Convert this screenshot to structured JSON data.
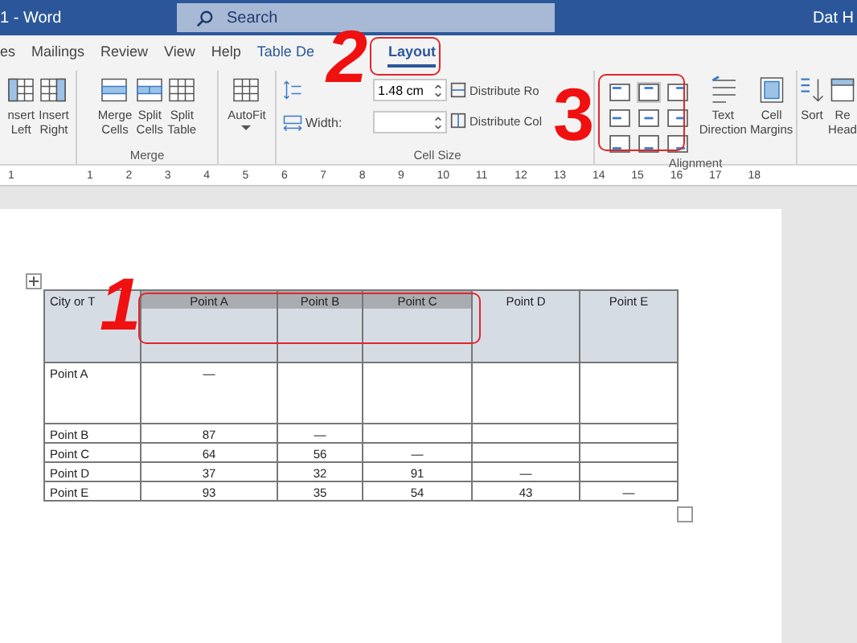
{
  "title_bar": {
    "doc_title": "1 - Word",
    "search_placeholder": "Search",
    "user": "Dat H"
  },
  "tabs": [
    {
      "label": "es",
      "selected": false
    },
    {
      "label": "Mailings",
      "selected": false
    },
    {
      "label": "Review",
      "selected": false
    },
    {
      "label": "View",
      "selected": false
    },
    {
      "label": "Help",
      "selected": false
    },
    {
      "label": "Table De",
      "selected": false
    },
    {
      "label": "Layout",
      "selected": true
    }
  ],
  "ribbon": {
    "groups": [
      {
        "items": [
          {
            "kind": "button",
            "lines": [
              "nsert",
              "Left"
            ]
          },
          {
            "kind": "button",
            "lines": [
              "Insert",
              "Right"
            ]
          }
        ]
      },
      {
        "label": "Merge",
        "items": [
          {
            "kind": "button",
            "lines": [
              "Merge",
              "Cells"
            ]
          },
          {
            "kind": "button",
            "lines": [
              "Split",
              "Cells"
            ]
          },
          {
            "kind": "button",
            "lines": [
              "Split",
              "Table"
            ]
          }
        ]
      },
      {
        "items": [
          {
            "kind": "dropdown",
            "lines": [
              "AutoFit"
            ]
          }
        ]
      },
      {
        "label": "Cell Size",
        "items": [
          {
            "kind": "size",
            "height_value": "1.48 cm",
            "width_label": "Width:"
          },
          {
            "kind": "distribute",
            "rows": "Distribute Ro",
            "cols": "Distribute Col"
          }
        ]
      },
      {
        "label": "Alignment",
        "items": [
          {
            "kind": "align",
            "cells": [
              {
                "selected": false
              },
              {
                "selected": true
              },
              {
                "selected": false
              },
              {
                "selected": false
              },
              {
                "selected": false
              },
              {
                "selected": false
              },
              {
                "selected": false
              },
              {
                "selected": false
              },
              {
                "selected": false
              }
            ]
          },
          {
            "kind": "button",
            "lines": [
              "Text",
              "Direction"
            ]
          },
          {
            "kind": "button",
            "lines": [
              "Cell",
              "Margins"
            ]
          }
        ]
      },
      {
        "items": [
          {
            "kind": "button",
            "lines": [
              "Sort"
            ]
          },
          {
            "kind": "button",
            "lines": [
              "Re",
              "Head"
            ]
          }
        ]
      }
    ]
  },
  "ruler": [
    "1",
    "1",
    "2",
    "3",
    "4",
    "5",
    "6",
    "7",
    "8",
    "9",
    "10",
    "11",
    "12",
    "13",
    "14",
    "15",
    "16",
    "17",
    "18"
  ],
  "table": {
    "header": [
      {
        "text": "City or T",
        "selected": false
      },
      {
        "text": "Point A",
        "selected": true
      },
      {
        "text": "Point B",
        "selected": true
      },
      {
        "text": "Point C",
        "selected": true
      },
      {
        "text": "Point D",
        "selected": false
      },
      {
        "text": "Point E",
        "selected": false
      }
    ],
    "rows": [
      [
        "Point A",
        "—",
        "",
        "",
        "",
        ""
      ],
      [
        "Point B",
        "87",
        "—",
        "",
        "",
        ""
      ],
      [
        "Point C",
        "64",
        "56",
        "—",
        "",
        ""
      ],
      [
        "Point D",
        "37",
        "32",
        "91",
        "—",
        ""
      ],
      [
        "Point E",
        "93",
        "35",
        "54",
        "43",
        "—"
      ]
    ]
  },
  "annotations": [
    "1",
    "2",
    "3"
  ]
}
